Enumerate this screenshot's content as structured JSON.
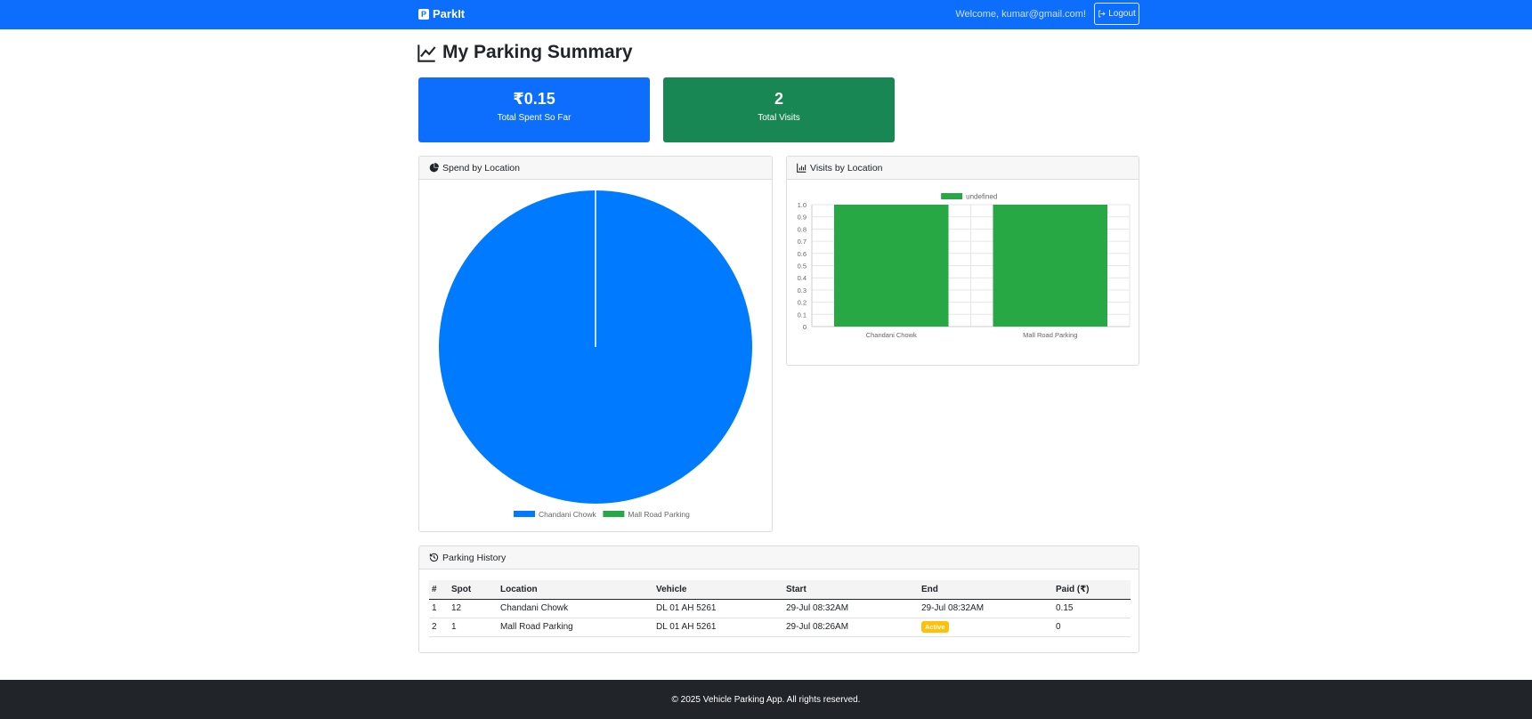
{
  "navbar": {
    "brand": "ParkIt",
    "brand_icon": "P",
    "welcome": "Welcome, kumar@gmail.com!",
    "logout_label": "Logout"
  },
  "page": {
    "title": "My Parking Summary"
  },
  "stats": {
    "total_spent_value": "₹0.15",
    "total_spent_label": "Total Spent So Far",
    "total_visits_value": "2",
    "total_visits_label": "Total Visits"
  },
  "spend_panel": {
    "title": "Spend by Location"
  },
  "visits_panel": {
    "title": "Visits by Location"
  },
  "history_panel": {
    "title": "Parking History",
    "columns": [
      "#",
      "Spot",
      "Location",
      "Vehicle",
      "Start",
      "End",
      "Paid (₹)"
    ],
    "rows": [
      {
        "num": "1",
        "spot": "12",
        "location": "Chandani Chowk",
        "vehicle": "DL 01 AH 5261",
        "start": "29-Jul 08:32AM",
        "end": "29-Jul 08:32AM",
        "paid": "0.15"
      },
      {
        "num": "2",
        "spot": "1",
        "location": "Mall Road Parking",
        "vehicle": "DL 01 AH 5261",
        "start": "29-Jul 08:26AM",
        "end_badge": "Active",
        "paid": "0"
      }
    ]
  },
  "footer": {
    "text": "© 2025 Vehicle Parking App. All rights reserved."
  },
  "colors": {
    "primary": "#0d6efd",
    "success": "#198754",
    "chart_blue": "#007bff",
    "chart_green": "#28a745",
    "warning": "#ffc107",
    "footer": "#212529"
  },
  "chart_data": [
    {
      "type": "pie",
      "categories": [
        "Chandani Chowk",
        "Mall Road Parking"
      ],
      "values": [
        0.15,
        0
      ],
      "colors": [
        "#007bff",
        "#28a745"
      ],
      "legend": "bottom"
    },
    {
      "type": "bar",
      "categories": [
        "Chandani Chowk",
        "Mall Road Parking"
      ],
      "series": [
        {
          "name": "undefined",
          "values": [
            1,
            1
          ],
          "color": "#28a745"
        }
      ],
      "yticks": [
        "0",
        "0.1",
        "0.2",
        "0.3",
        "0.4",
        "0.5",
        "0.6",
        "0.7",
        "0.8",
        "0.9",
        "1.0"
      ],
      "ylim": [
        0,
        1
      ],
      "grid": true,
      "legend": "top"
    }
  ]
}
